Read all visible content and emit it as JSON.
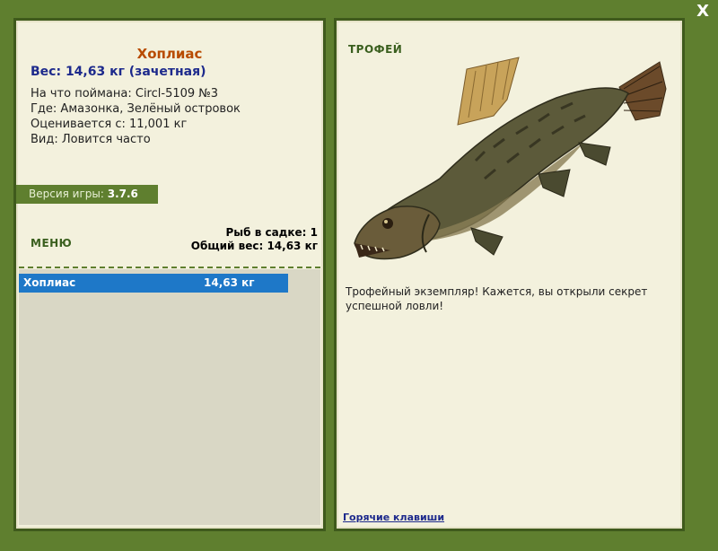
{
  "window": {
    "close_label": "X"
  },
  "fish": {
    "name": "Хоплиас",
    "weight_line": "Вес: 14,63 кг (зачетная)",
    "info": [
      "На что поймана: Circl-5109 №3",
      "Где: Амазонка, Зелёный островок",
      "Оценивается с: 11,001 кг",
      "Вид: Ловится часто"
    ]
  },
  "version": {
    "label": "Версия игры:",
    "value": "3.7.6"
  },
  "menu": {
    "label": "МЕНЮ"
  },
  "cage": {
    "count_line": "Рыб в садке: 1",
    "total_line": "Общий вес: 14,63 кг",
    "items": [
      {
        "name": "Хоплиас",
        "weight": "14,63 кг"
      }
    ]
  },
  "trophy": {
    "title": "ТРОФЕЙ",
    "text": "Трофейный экземпляр! Кажется, вы открыли секрет успешной ловли!",
    "hotkeys_label": "Горячие клавиши"
  },
  "colors": {
    "background": "#5f7f2f",
    "panel": "#f3f1dd",
    "accent_blue": "#1e78c8",
    "fish_name": "#b84b00"
  }
}
